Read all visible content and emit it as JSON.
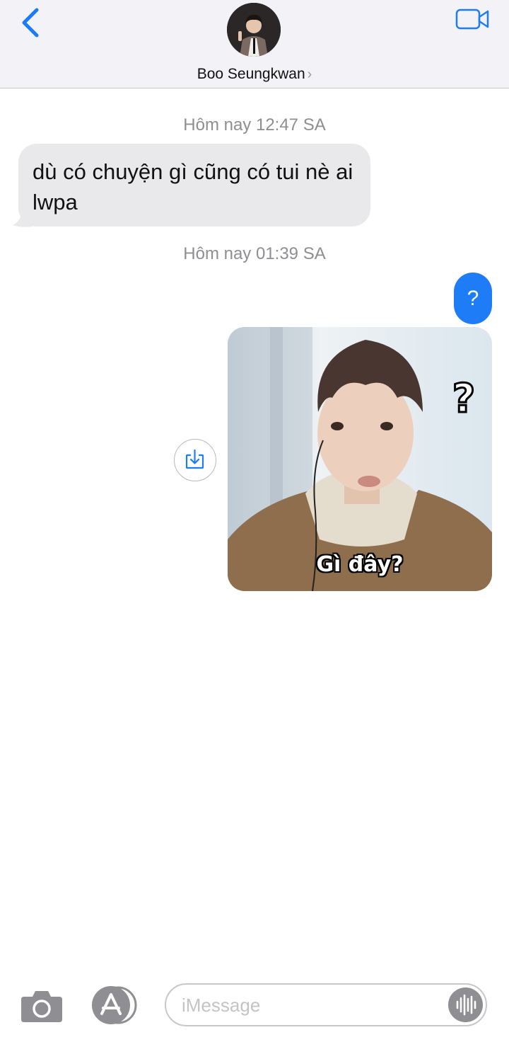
{
  "header": {
    "contact_name": "Boo Seungkwan",
    "name_chevron": "›",
    "back_icon": "chevron-left-icon",
    "video_icon": "video-camera-icon",
    "accent_color": "#1e7cf6"
  },
  "conversation": {
    "timestamp_1": "Hôm nay 12:47 SA",
    "incoming_message": "dù có chuyện gì cũng có tui nè ai lwpa",
    "timestamp_2": "Hôm nay 01:39 SA",
    "outgoing_message": "?",
    "photo_caption": "Gì đây?",
    "photo_sticker": "?",
    "incoming_bubble_color": "#e9e9eb",
    "outgoing_bubble_color": "#1e7cf6"
  },
  "composer": {
    "placeholder": "iMessage",
    "camera_icon": "camera-icon",
    "apps_icon": "app-store-icon",
    "audio_icon": "audio-waveform-icon"
  }
}
